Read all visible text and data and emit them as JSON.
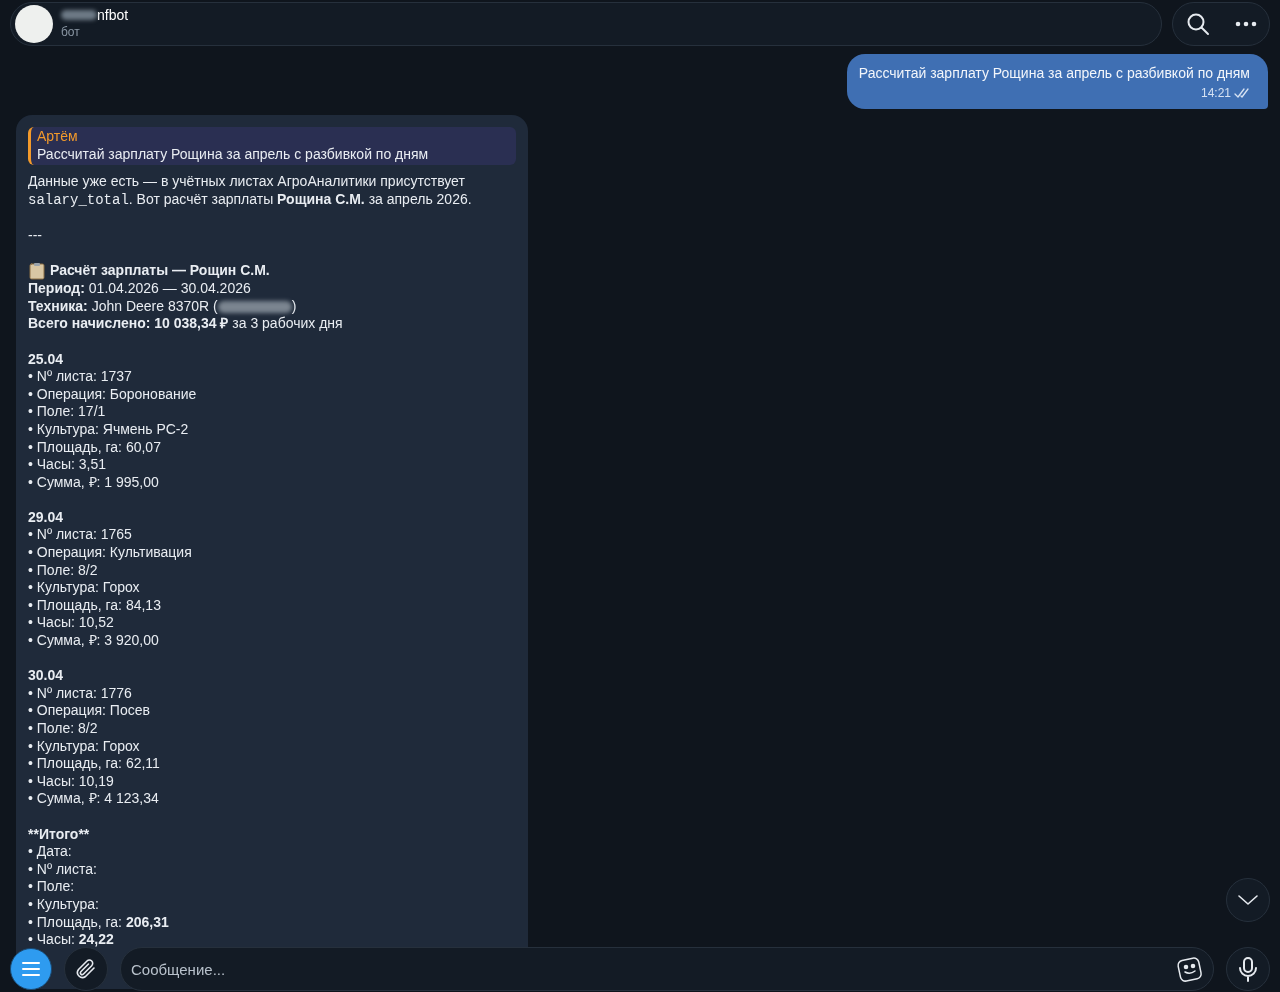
{
  "header": {
    "name": "nfbot",
    "subtitle": "бот"
  },
  "outgoing": {
    "text": "Рассчитай зарплату Рощина за апрель с разбивкой по дням",
    "time": "14:21",
    "read": true
  },
  "incoming": {
    "reply": {
      "author": "Артём",
      "text": "Рассчитай зарплату Рощина за апрель с разбивкой по дням"
    },
    "intro": [
      {
        "kind": "text",
        "text": "Данные уже есть — в учётных листах АгроАналитики присутствует "
      },
      {
        "kind": "code",
        "text": "salary_total"
      },
      {
        "kind": "text",
        "text": ". Вот расчёт зарплаты **Рощина С.М.** за апрель 2026."
      }
    ],
    "separator": "---",
    "title": "Расчёт зарплаты — Рощин С.М.",
    "summary": [
      {
        "kind": "text",
        "text": "**Период:** 01.04.2026 — 30.04.2026"
      },
      {
        "kind": "redacted",
        "before": "**Техника:** John Deere 8370R (",
        "after": ")"
      },
      {
        "kind": "text",
        "text": "**Всего начислено: 10 038,34 ₽** за 3 рабочих дня"
      }
    ],
    "days": [
      {
        "date": "25.04",
        "items": [
          "• Nº листа: 1737",
          "• Операция: Боронование",
          "• Поле: 17/1",
          "• Культура: Ячмень РС-2",
          "• Площадь, га: 60,07",
          "• Часы: 3,51",
          "• Сумма, ₽: 1 995,00"
        ]
      },
      {
        "date": "29.04",
        "items": [
          "• Nº листа: 1765",
          "• Операция: Культивация",
          "• Поле: 8/2",
          "• Культура: Горох",
          "• Площадь, га: 84,13",
          "• Часы: 10,52",
          "• Сумма, ₽: 3 920,00"
        ]
      },
      {
        "date": "30.04",
        "items": [
          "• Nº листа: 1776",
          "• Операция: Посев",
          "• Поле: 8/2",
          "• Культура: Горох",
          "• Площадь, га: 62,11",
          "• Часы: 10,19",
          "• Сумма, ₽: 4 123,34"
        ]
      }
    ],
    "total": {
      "title": "**Итого**",
      "items": [
        "• Дата:",
        "• Nº листа:",
        "• Поле:",
        "• Культура:",
        "• Площадь, га: **206,31**",
        "• Часы: **24,22**"
      ]
    }
  },
  "composer": {
    "placeholder": "Сообщение..."
  }
}
